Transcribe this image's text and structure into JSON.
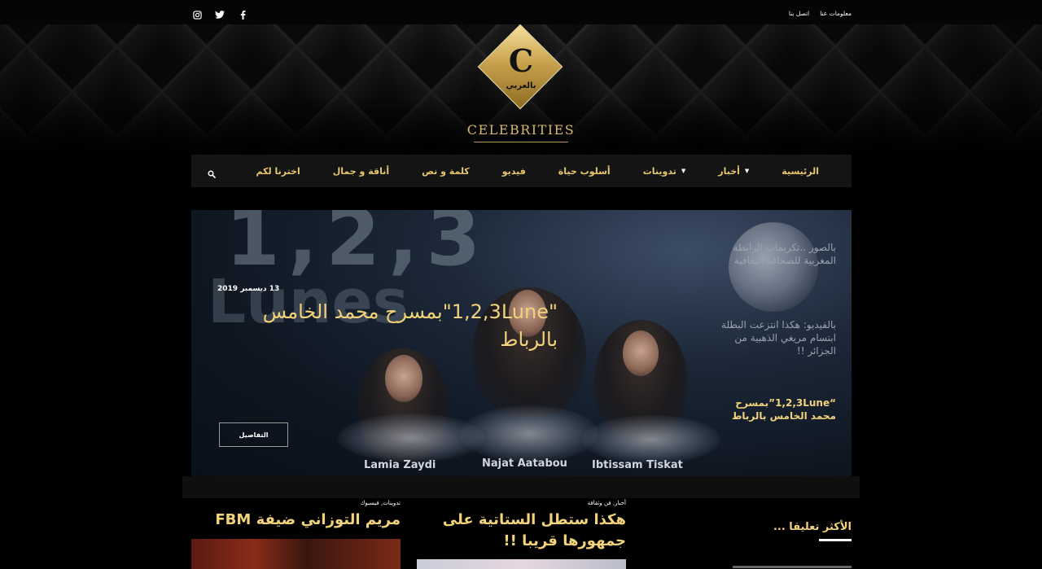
{
  "topbar": {
    "links": [
      "معلومات عنا",
      "اتصل بنا"
    ],
    "socials": [
      "facebook-icon",
      "twitter-icon",
      "instagram-icon"
    ]
  },
  "logo": {
    "letter": "C",
    "arabic": "بالعربي",
    "wordmark": "CELEBRITIES"
  },
  "nav": {
    "items": [
      {
        "label": "الرئيسية",
        "dropdown": false
      },
      {
        "label": "أخبار",
        "dropdown": true
      },
      {
        "label": "تدوينات",
        "dropdown": true
      },
      {
        "label": "أسلوب حياة",
        "dropdown": false
      },
      {
        "label": "فيديو",
        "dropdown": false
      },
      {
        "label": "كلمة و نص",
        "dropdown": false
      },
      {
        "label": "أناقة و جمال",
        "dropdown": false
      },
      {
        "label": "اخترنا لكم",
        "dropdown": false
      }
    ],
    "search_icon": "search-icon"
  },
  "hero": {
    "bg_numbers": "1,2,3",
    "bg_word": "Lunes",
    "names": [
      "Lamia Zaydi",
      "Najat Aatabou",
      "Ibtissam Tiskat"
    ],
    "date": "13 ديسمبر 2019",
    "title": "\"1,2,3Lune\"بمسرح محمد الخامس بالرباط",
    "button": "التفاصيل",
    "side_posts": [
      {
        "text": "بالصور ..تكريمات الرابطة المغربية للصحافة الثقافية",
        "active": false
      },
      {
        "text": "بالفيديو: هكذا انتزعت البطلة ابتسام مريغي الذهبية من الجزائر !!",
        "active": false
      },
      {
        "text": "“1,2,3Lune”بمسرح محمد الخامس بالرباط",
        "active": true
      }
    ]
  },
  "cards": [
    {
      "category": "تدوينات, فيسبوك",
      "title": "مريم التوزاني ضيفة FBM"
    },
    {
      "category": "أخبار, فن وثقافة",
      "title": "هكذا ستطل الستاتية على جمهورها قريبا !!"
    }
  ],
  "widget": {
    "title": "الأكثر تعليقا ..."
  },
  "colors": {
    "accent": "#f2d27a",
    "nav_bg": "#141414",
    "gold": "#c9a24e"
  }
}
